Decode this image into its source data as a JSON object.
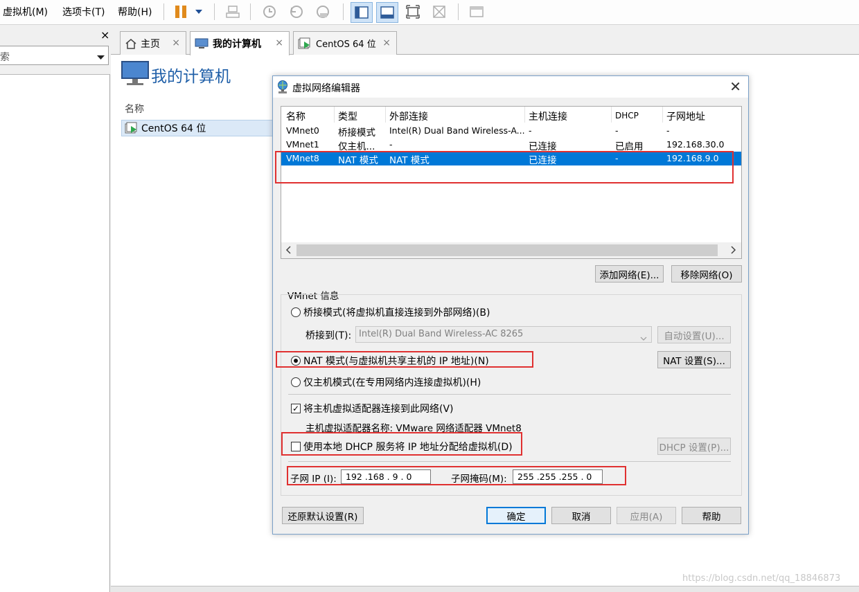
{
  "menubar": {
    "items": [
      "虚拟机(M)",
      "选项卡(T)",
      "帮助(H)"
    ]
  },
  "library": {
    "close_glyph": "×",
    "search_placeholder": "索"
  },
  "tabs": [
    {
      "label": "主页",
      "close": "×"
    },
    {
      "label": "我的计算机",
      "close": "×"
    },
    {
      "label": "CentOS 64 位",
      "close": "×"
    }
  ],
  "main": {
    "page_title": "我的计算机",
    "column_name": "名称",
    "vm_item": "CentOS 64 位"
  },
  "dialog": {
    "title": "虚拟网络编辑器",
    "close": "✕",
    "table": {
      "headers": [
        "名称",
        "类型",
        "外部连接",
        "主机连接",
        "DHCP",
        "子网地址"
      ],
      "rows": [
        [
          "VMnet0",
          "桥接模式",
          "Intel(R) Dual Band Wireless-A...",
          "-",
          "-",
          "-"
        ],
        [
          "VMnet1",
          "仅主机...",
          "-",
          "已连接",
          "已启用",
          "192.168.30.0"
        ],
        [
          "VMnet8",
          "NAT 模式",
          "NAT 模式",
          "已连接",
          "-",
          "192.168.9.0"
        ]
      ],
      "selected_row": 2
    },
    "add_network": "添加网络(E)...",
    "remove_network": "移除网络(O)",
    "group_title": "VMnet 信息",
    "bridge_mode": "桥接模式(将虚拟机直接连接到外部网络)(B)",
    "bridge_to_label": "桥接到(T):",
    "bridge_to_value": "Intel(R) Dual Band Wireless-AC 8265",
    "auto_settings": "自动设置(U)...",
    "nat_mode": "NAT 模式(与虚拟机共享主机的 IP 地址)(N)",
    "nat_settings": "NAT 设置(S)...",
    "host_only_mode": "仅主机模式(在专用网络内连接虚拟机)(H)",
    "connect_adapter": "将主机虚拟适配器连接到此网络(V)",
    "adapter_name": "主机虚拟适配器名称: VMware 网络适配器 VMnet8",
    "use_dhcp": "使用本地 DHCP 服务将 IP 地址分配给虚拟机(D)",
    "dhcp_settings": "DHCP 设置(P)...",
    "subnet_ip_label": "子网 IP (I):",
    "subnet_ip_value": "192 .168 .  9  .  0",
    "subnet_mask_label": "子网掩码(M):",
    "subnet_mask_value": "255 .255 .255 .  0",
    "restore_defaults": "还原默认设置(R)",
    "ok": "确定",
    "cancel": "取消",
    "apply": "应用(A)",
    "help": "帮助"
  },
  "watermark": "https://blog.csdn.net/qq_18846873"
}
